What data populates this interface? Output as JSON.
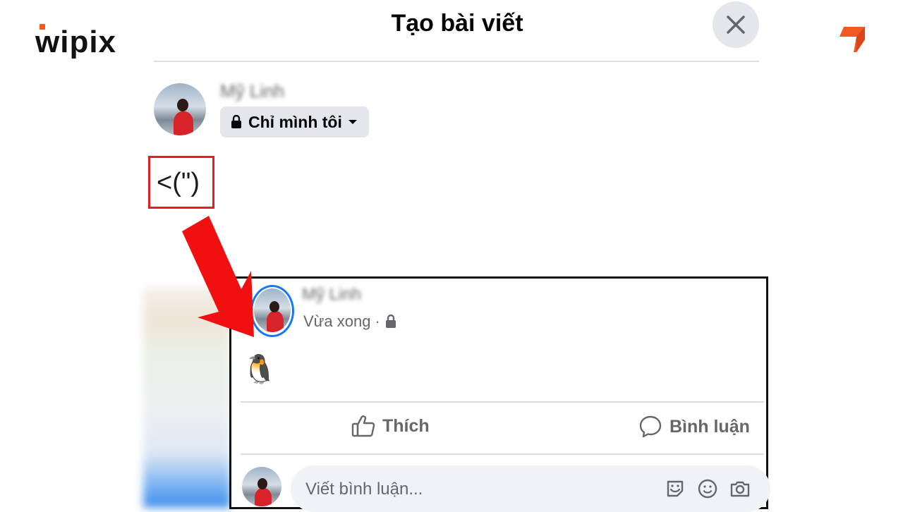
{
  "brand": {
    "logo_text": "wipix",
    "accent": "#f25a22"
  },
  "dialog": {
    "title": "Tạo bài viết",
    "close_icon": "close-icon",
    "author_name": "Mỹ Linh",
    "privacy_label": "Chỉ mình tôi",
    "typed_text": "<(\")"
  },
  "post": {
    "author_name": "Mỹ Linh",
    "timestamp": "Vừa xong",
    "separator": "·",
    "content_emoji": "🐧",
    "actions": {
      "like_label": "Thích",
      "comment_label": "Bình luận"
    },
    "comment_placeholder": "Viết bình luận..."
  },
  "colors": {
    "highlight_red": "#e51c23",
    "facebook_blue": "#1877f2",
    "arrow_red": "#f01010"
  }
}
